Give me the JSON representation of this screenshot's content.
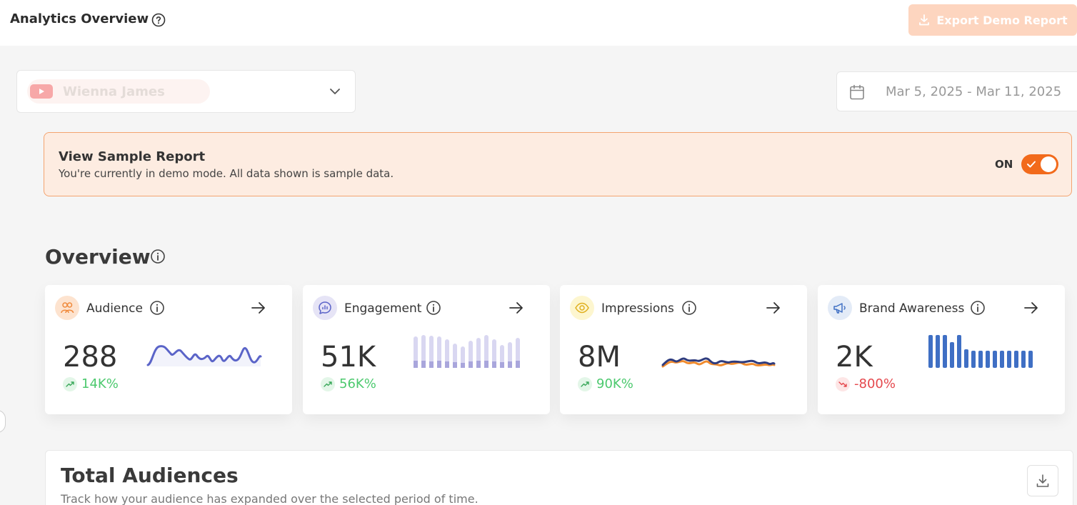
{
  "header": {
    "title": "Analytics Overview",
    "export_label": "Export Demo Report"
  },
  "account": {
    "name": "Wienna James",
    "platform_icon": "youtube-icon"
  },
  "date_range": "Mar 5, 2025 - Mar 11, 2025",
  "banner": {
    "title": "View Sample Report",
    "subtitle": "You're currently in demo mode. All data shown is sample data.",
    "toggle_label": "ON",
    "toggle_on": true
  },
  "overview": {
    "title": "Overview",
    "cards": [
      {
        "label": "Audience",
        "value": "288",
        "change": "14K%",
        "trend": "up",
        "icon": "audience-icon",
        "chart": "line"
      },
      {
        "label": "Engagement",
        "value": "51K",
        "change": "56K%",
        "trend": "up",
        "icon": "engagement-icon",
        "chart": "bars"
      },
      {
        "label": "Impressions",
        "value": "8M",
        "change": "90K%",
        "trend": "up",
        "icon": "eye-icon",
        "chart": "multi-line"
      },
      {
        "label": "Brand Awareness",
        "value": "2K",
        "change": "-800%",
        "trend": "down",
        "icon": "megaphone-icon",
        "chart": "bars"
      }
    ]
  },
  "total_audiences": {
    "title": "Total Audiences",
    "subtitle": "Track how your audience has expanded over the selected period of time."
  },
  "colors": {
    "accent": "#f26a1b",
    "banner_bg": "#fdece1",
    "up": "#4cc96e",
    "down": "#e5484d",
    "audience_line": "#5b64c8",
    "engagement_bar": "#a9a6dc",
    "brand_bar": "#3f6fc4",
    "impr_dark": "#2f3c7e",
    "impr_orange": "#f08a2c"
  }
}
